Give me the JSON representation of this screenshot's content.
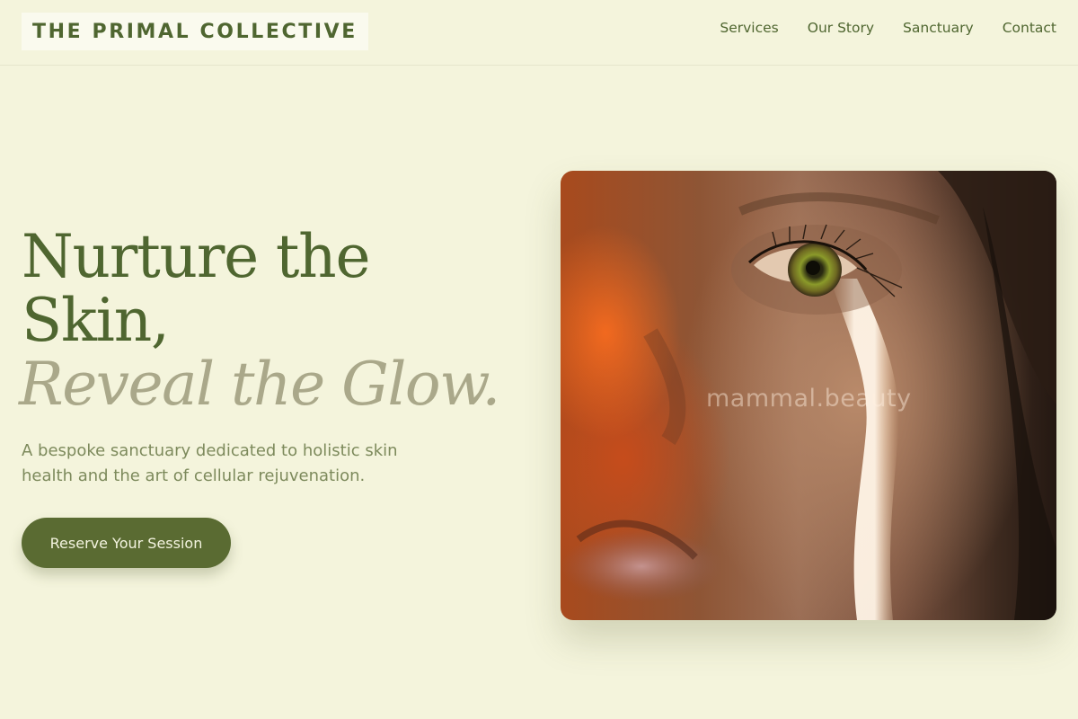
{
  "header": {
    "brand": "THE PRIMAL COLLECTIVE",
    "nav": [
      {
        "label": "Services"
      },
      {
        "label": "Our Story"
      },
      {
        "label": "Sanctuary"
      },
      {
        "label": "Contact"
      }
    ]
  },
  "hero": {
    "headline_line1": "Nurture the",
    "headline_line2": "Skin,",
    "headline_line3": "Reveal the Glow.",
    "subtitle": "A bespoke sanctuary dedicated to holistic skin health and the art of cellular rejuvenation.",
    "cta_label": "Reserve Your Session",
    "image": {
      "watermark": "mammal.beauty"
    }
  },
  "colors": {
    "background": "#f4f4dc",
    "brand_green": "#4f6630",
    "accent_italic": "#aaa88a",
    "button": "#5a6b32"
  }
}
